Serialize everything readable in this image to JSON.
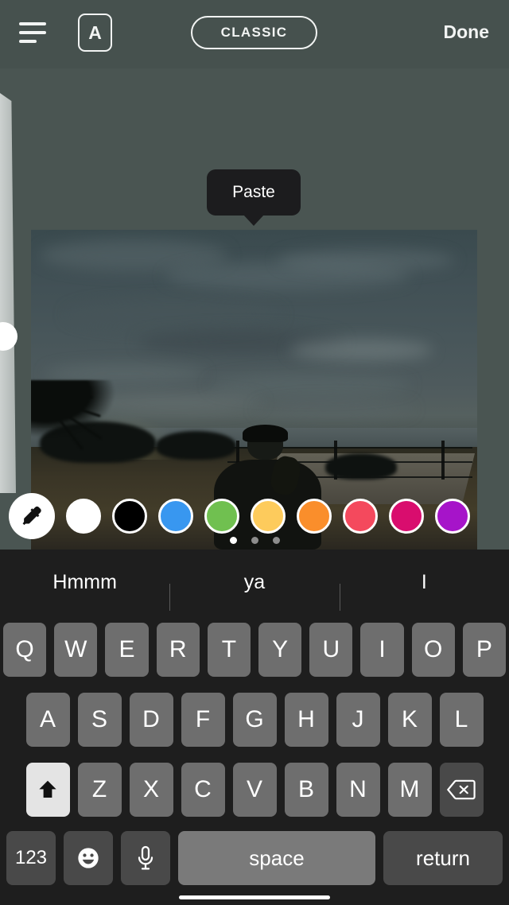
{
  "theme": {
    "app_background": "#4a5552",
    "topbar_background": "#46514e",
    "keyboard_background": "#1e1e1e",
    "key_background": "#6e6e6e",
    "key_dark_background": "#494949",
    "shift_active_background": "#e4e4e4",
    "tooltip_background": "#1c1c1e",
    "text_on_dark": "#ffffff"
  },
  "topbar": {
    "align_icon": "text-align-icon",
    "text_style_label": "A",
    "font_pill_label": "CLASSIC",
    "done_label": "Done"
  },
  "slider": {
    "name": "text-size-slider",
    "thumb": "slider-thumb"
  },
  "tooltip": {
    "label": "Paste"
  },
  "canvas": {
    "media_type": "photo",
    "description": "Dark dusk photo of a person sitting on grass by a fence overlooking the ocean with a palm tree"
  },
  "colors": {
    "eyedropper_icon": "eyedropper-icon",
    "swatches": [
      {
        "name": "white",
        "hex": "#ffffff"
      },
      {
        "name": "black",
        "hex": "#000000"
      },
      {
        "name": "blue",
        "hex": "#3897f0"
      },
      {
        "name": "green",
        "hex": "#70c050"
      },
      {
        "name": "yellow",
        "hex": "#fdcb5c"
      },
      {
        "name": "orange",
        "hex": "#fa8e2b"
      },
      {
        "name": "red",
        "hex": "#f4495d"
      },
      {
        "name": "magenta",
        "hex": "#d90d6e"
      },
      {
        "name": "purple",
        "hex": "#a614c9"
      }
    ],
    "page_dots": {
      "count": 3,
      "active_index": 0
    }
  },
  "keyboard": {
    "suggestions": [
      "Hmmm",
      "ya",
      "I"
    ],
    "row1": [
      "Q",
      "W",
      "E",
      "R",
      "T",
      "Y",
      "U",
      "I",
      "O",
      "P"
    ],
    "row2": [
      "A",
      "S",
      "D",
      "F",
      "G",
      "H",
      "J",
      "K",
      "L"
    ],
    "row3_letters": [
      "Z",
      "X",
      "C",
      "V",
      "B",
      "N",
      "M"
    ],
    "shift_icon": "shift-arrow-icon",
    "backspace_icon": "backspace-icon",
    "numbers_label": "123",
    "emoji_icon": "emoji-smiley-icon",
    "dictation_icon": "microphone-icon",
    "space_label": "space",
    "return_label": "return"
  }
}
